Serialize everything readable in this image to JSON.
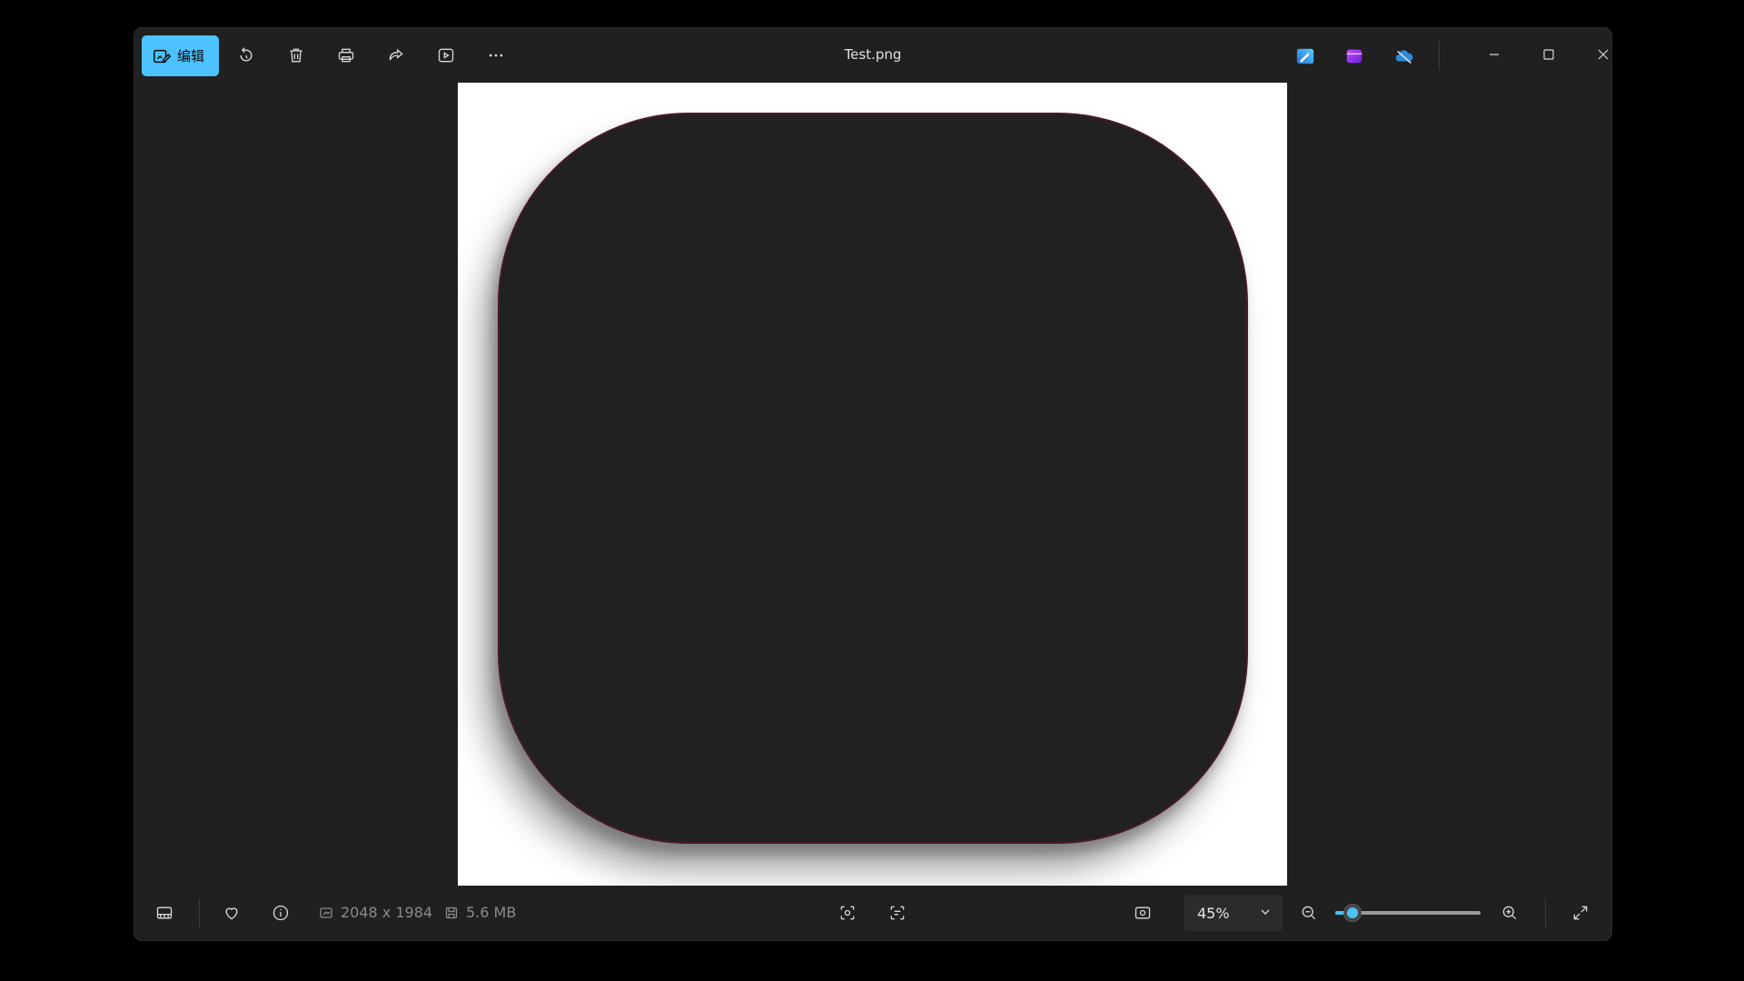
{
  "window": {
    "title": "Test.png"
  },
  "toolbar": {
    "edit_label": "编辑",
    "icons": [
      "rotate-icon",
      "delete-icon",
      "print-icon",
      "share-icon",
      "slideshow-icon",
      "more-icon"
    ]
  },
  "apps": [
    "photos-editor-icon",
    "clipchamp-icon",
    "onedrive-icon"
  ],
  "image": {
    "shape_color": "#212121",
    "outline_color": "#4a1a24",
    "background": "#ffffff"
  },
  "bottombar": {
    "dimensions": "2048 x 1984",
    "file_size": "5.6 MB",
    "zoom_label": "45%",
    "zoom_fraction": 0.12
  },
  "colors": {
    "accent": "#4cc2ff",
    "window_bg": "#202020"
  }
}
